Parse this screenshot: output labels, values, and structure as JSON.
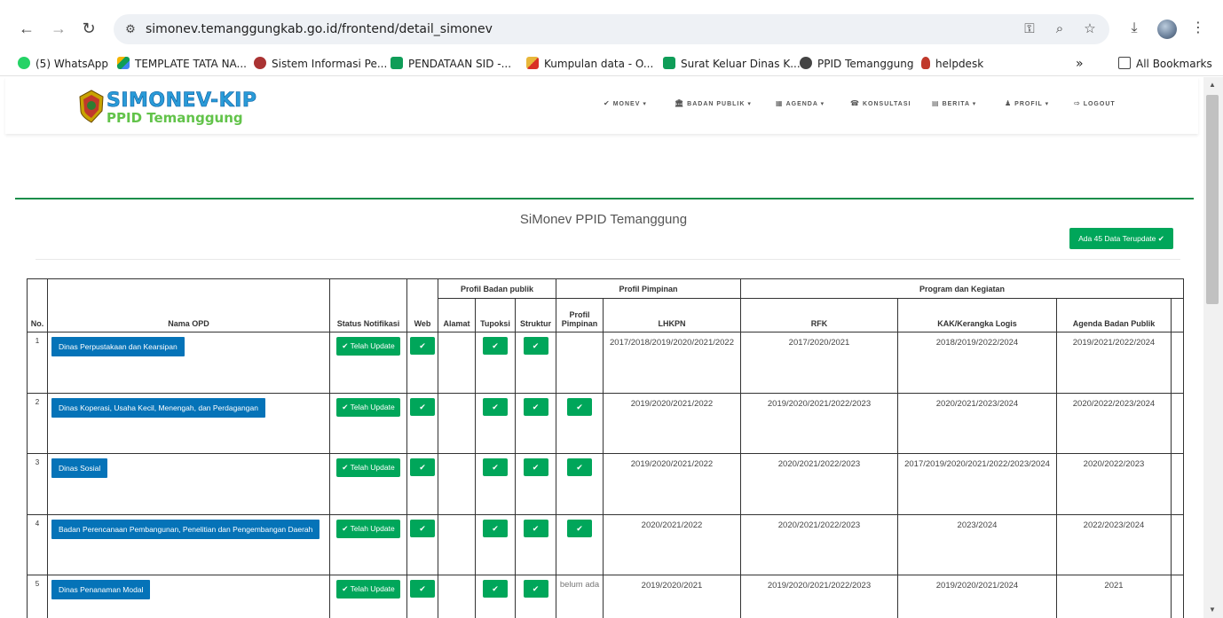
{
  "browser": {
    "url": "simonev.temanggungkab.go.id/frontend/detail_simonev",
    "bookmarks": [
      {
        "label": "(5) WhatsApp",
        "color": "#25d366"
      },
      {
        "label": "TEMPLATE TATA NA...",
        "color": "#f4b400"
      },
      {
        "label": "Sistem Informasi Pe...",
        "color": "#a33"
      },
      {
        "label": "PENDATAAN SID -...",
        "color": "#0f9d58"
      },
      {
        "label": "Kumpulan data - O...",
        "color": "#e8b73a"
      },
      {
        "label": "Surat Keluar Dinas K...",
        "color": "#0f9d58"
      },
      {
        "label": "PPID Temanggung",
        "color": "#444"
      },
      {
        "label": "helpdesk",
        "color": "#c0392b"
      }
    ],
    "all_bookmarks": "All Bookmarks",
    "more_chevron": "»"
  },
  "site": {
    "logo_title": "SIMONEV-KIP",
    "logo_subtitle": "PPID Temanggung",
    "menu": [
      {
        "icon": "✔",
        "label": "MONEV ▾"
      },
      {
        "icon": "🏛",
        "label": "BADAN PUBLIK ▾"
      },
      {
        "icon": "▦",
        "label": "AGENDA ▾"
      },
      {
        "icon": "☎",
        "label": "KONSULTASI"
      },
      {
        "icon": "▤",
        "label": "BERITA ▾"
      },
      {
        "icon": "♟",
        "label": "PROFIL ▾"
      },
      {
        "icon": "⇨",
        "label": "LOGOUT"
      }
    ]
  },
  "main": {
    "title": "SiMonev PPID Temanggung",
    "update_button": "Ada 45 Data Terupdate ✔"
  },
  "table": {
    "group_headers": {
      "profil_badan": "Profil Badan publik",
      "profil_pimpinan": "Profil Pimpinan",
      "program": "Program dan Kegiatan"
    },
    "headers": {
      "no": "No.",
      "nama": "Nama OPD",
      "status": "Status Notifikasi",
      "web": "Web",
      "alamat": "Alamat",
      "tupoksi": "Tupoksi",
      "struktur": "Struktur",
      "profil_pimpinan": "Profil Pimpinan",
      "lhkpn": "LHKPN",
      "rfk": "RFK",
      "kak": "KAK/Kerangka Logis",
      "agenda": "Agenda Badan Publik"
    },
    "status_label": "✔ Telah Update",
    "check": "✔",
    "rows": [
      {
        "no": "1",
        "nama": "Dinas Perpustakaan dan Kearsipan",
        "pimpinan": "",
        "lhkpn": "2017/2018/2019/2020/2021/2022",
        "rfk": "2017/2020/2021",
        "kak": "2018/2019/2022/2024",
        "agenda": "2019/2021/2022/2024"
      },
      {
        "no": "2",
        "nama": "Dinas Koperasi, Usaha Kecil, Menengah, dan Perdagangan",
        "pimpinan": "check",
        "lhkpn": "2019/2020/2021/2022",
        "rfk": "2019/2020/2021/2022/2023",
        "kak": "2020/2021/2023/2024",
        "agenda": "2020/2022/2023/2024"
      },
      {
        "no": "3",
        "nama": "Dinas Sosial",
        "pimpinan": "check",
        "lhkpn": "2019/2020/2021/2022",
        "rfk": "2020/2021/2022/2023",
        "kak": "2017/2019/2020/2021/2022/2023/2024",
        "agenda": "2020/2022/2023"
      },
      {
        "no": "4",
        "nama": "Badan Perencanaan Pembangunan, Penelitian dan Pengembangan Daerah",
        "pimpinan": "check",
        "lhkpn": "2020/2021/2022",
        "rfk": "2020/2021/2022/2023",
        "kak": "2023/2024",
        "agenda": "2022/2023/2024"
      },
      {
        "no": "5",
        "nama": "Dinas Penanaman Modal",
        "pimpinan": "belum ada",
        "lhkpn": "2019/2020/2021",
        "rfk": "2019/2020/2021/2022/2023",
        "kak": "2019/2020/2021/2024",
        "agenda": "2021"
      }
    ]
  }
}
